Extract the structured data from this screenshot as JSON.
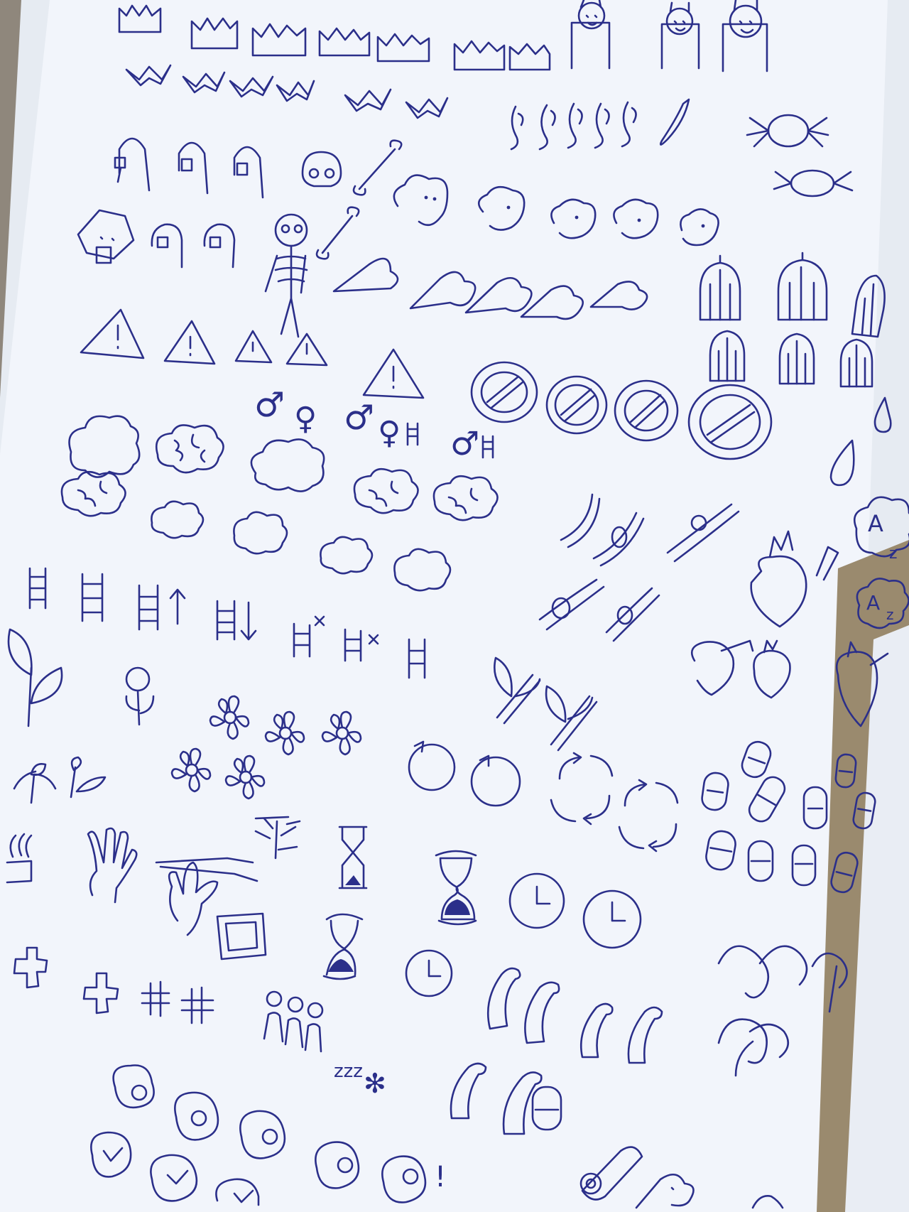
{
  "photo": {
    "ink_color": "#2b2f8a",
    "paper_color": "#f2f5fb",
    "desk_color": "#8f877c",
    "spine_color": "#9a8a6e"
  },
  "page": {
    "visible_text": [
      {
        "label": "male-symbol-1",
        "text": "♂"
      },
      {
        "label": "female-symbol-1",
        "text": "♀"
      },
      {
        "label": "male-symbol-2",
        "text": "♂"
      },
      {
        "label": "female-symbol-2",
        "text": "♀"
      },
      {
        "label": "male-symbol-3",
        "text": "♂"
      },
      {
        "label": "sleep-letter-A-1",
        "text": "A"
      },
      {
        "label": "sleep-letter-z-1",
        "text": "z"
      },
      {
        "label": "sleep-letter-A-2",
        "text": "A"
      },
      {
        "label": "sleep-letter-z-2",
        "text": "z"
      },
      {
        "label": "sleep-zzz",
        "text": "zzz"
      },
      {
        "label": "snowflake-symbol",
        "text": "✻"
      },
      {
        "label": "exclamation-mark",
        "text": "!"
      }
    ]
  }
}
